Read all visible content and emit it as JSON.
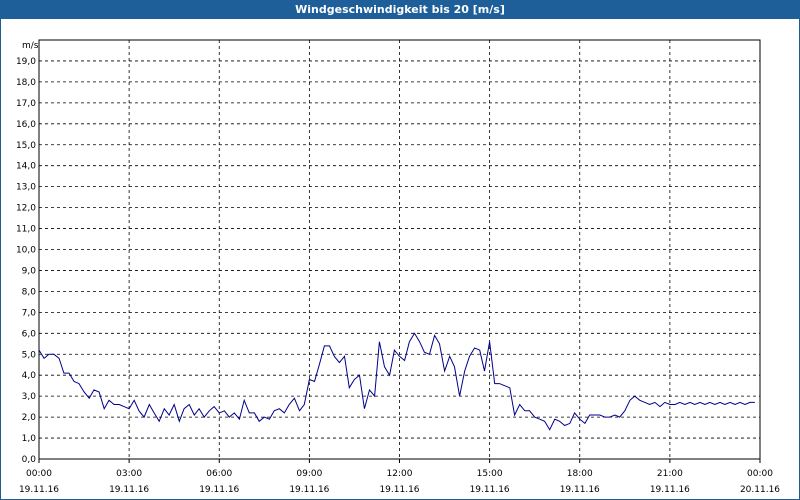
{
  "window": {
    "title": "Windgeschwindigkeit bis 20 [m/s]"
  },
  "chart_data": {
    "type": "line",
    "title": "Windgeschwindigkeit bis 20 [m/s]",
    "ylabel": "m/s",
    "xlabel": "",
    "ylim": [
      0,
      20
    ],
    "xlim": [
      0,
      24
    ],
    "grid": true,
    "line_color": "#00008b",
    "yticks": [
      "0,0",
      "1,0",
      "2,0",
      "3,0",
      "4,0",
      "5,0",
      "6,0",
      "7,0",
      "8,0",
      "9,0",
      "10,0",
      "11,0",
      "12,0",
      "13,0",
      "14,0",
      "15,0",
      "16,0",
      "17,0",
      "18,0",
      "19,0"
    ],
    "xticks": [
      {
        "time": "00:00",
        "date": "19.11.16"
      },
      {
        "time": "03:00",
        "date": "19.11.16"
      },
      {
        "time": "06:00",
        "date": "19.11.16"
      },
      {
        "time": "09:00",
        "date": "19.11.16"
      },
      {
        "time": "12:00",
        "date": "19.11.16"
      },
      {
        "time": "15:00",
        "date": "19.11.16"
      },
      {
        "time": "18:00",
        "date": "19.11.16"
      },
      {
        "time": "21:00",
        "date": "19.11.16"
      },
      {
        "time": "00:00",
        "date": "20.11.16"
      }
    ],
    "series": [
      {
        "x": [
          0.0,
          0.17,
          0.33,
          0.5,
          0.67,
          0.83,
          1.0,
          1.17,
          1.33,
          1.5,
          1.67,
          1.83,
          2.0,
          2.17,
          2.33,
          2.5,
          2.67,
          2.83,
          3.0,
          3.17,
          3.33,
          3.5,
          3.67,
          3.83,
          4.0,
          4.17,
          4.33,
          4.5,
          4.67,
          4.83,
          5.0,
          5.17,
          5.33,
          5.5,
          5.67,
          5.83,
          6.0,
          6.17,
          6.33,
          6.5,
          6.67,
          6.83,
          7.0,
          7.17,
          7.33,
          7.5,
          7.67,
          7.83,
          8.0,
          8.17,
          8.33,
          8.5,
          8.67,
          8.83,
          9.0,
          9.17,
          9.33,
          9.5,
          9.67,
          9.83,
          10.0,
          10.17,
          10.33,
          10.5,
          10.67,
          10.83,
          11.0,
          11.17,
          11.33,
          11.5,
          11.67,
          11.83,
          12.0,
          12.17,
          12.33,
          12.5,
          12.67,
          12.83,
          13.0,
          13.17,
          13.33,
          13.5,
          13.67,
          13.83,
          14.0,
          14.17,
          14.33,
          14.5,
          14.67,
          14.83,
          15.0,
          15.17,
          15.33,
          15.5,
          15.67,
          15.83,
          16.0,
          16.17,
          16.33,
          16.5,
          16.67,
          16.83,
          17.0,
          17.17,
          17.33,
          17.5,
          17.67,
          17.83,
          18.0,
          18.17,
          18.33,
          18.5,
          18.67,
          18.83,
          19.0,
          19.17,
          19.33,
          19.5,
          19.67,
          19.83,
          20.0,
          20.17,
          20.33,
          20.5,
          20.67,
          20.83,
          21.0,
          21.17,
          21.33,
          21.5,
          21.67,
          21.83,
          22.0,
          22.17,
          22.33,
          22.5,
          22.67,
          22.83,
          23.0,
          23.17,
          23.33,
          23.5,
          23.67,
          23.83
        ],
        "y": [
          5.2,
          4.8,
          5.0,
          5.0,
          4.8,
          4.1,
          4.1,
          3.7,
          3.6,
          3.2,
          2.9,
          3.3,
          3.2,
          2.4,
          2.8,
          2.6,
          2.6,
          2.5,
          2.4,
          2.8,
          2.3,
          2.0,
          2.6,
          2.2,
          1.8,
          2.4,
          2.1,
          2.6,
          1.8,
          2.4,
          2.6,
          2.1,
          2.4,
          2.0,
          2.3,
          2.5,
          2.2,
          2.3,
          2.0,
          2.2,
          1.9,
          2.8,
          2.2,
          2.2,
          1.8,
          2.0,
          1.9,
          2.3,
          2.4,
          2.2,
          2.6,
          2.9,
          2.3,
          2.6,
          3.8,
          3.7,
          4.5,
          5.4,
          5.4,
          4.9,
          4.6,
          4.9,
          3.4,
          3.8,
          4.0,
          2.4,
          3.3,
          3.0,
          5.6,
          4.4,
          4.0,
          5.2,
          4.9,
          4.7,
          5.6,
          6.0,
          5.6,
          5.1,
          5.0,
          5.9,
          5.5,
          4.2,
          4.9,
          4.4,
          3.0,
          4.2,
          4.9,
          5.3,
          5.2,
          4.2,
          5.6,
          3.6,
          3.6,
          3.5,
          3.4,
          2.1,
          2.6,
          2.3,
          2.3,
          2.0,
          1.9,
          1.8,
          1.4,
          1.9,
          1.8,
          1.6,
          1.7,
          2.2,
          1.9,
          1.7,
          2.1,
          2.1,
          2.1,
          2.0,
          2.0,
          2.1,
          2.0,
          2.3,
          2.8,
          3.0,
          2.8,
          2.7,
          2.6,
          2.7,
          2.5,
          2.7,
          2.6,
          2.6,
          2.7,
          2.6,
          2.7,
          2.6,
          2.7,
          2.6,
          2.7,
          2.6,
          2.7,
          2.6,
          2.7,
          2.6,
          2.7,
          2.6,
          2.7,
          2.7
        ]
      }
    ]
  }
}
